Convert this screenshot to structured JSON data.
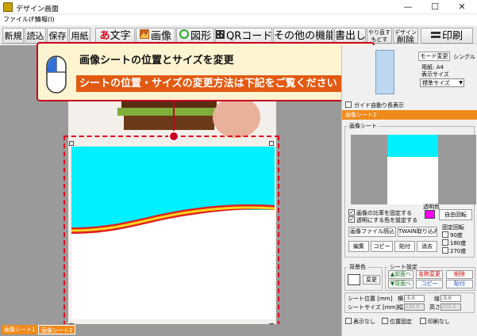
{
  "window": {
    "title": "デザイン画面",
    "minimize": "—",
    "maximize": "☐",
    "close": "✕"
  },
  "menu": [
    "ファイル(F)",
    "情報(I)"
  ],
  "toolbar": {
    "new": "新規",
    "load": "読込",
    "save": "保存",
    "paper": "用紙",
    "text_glyph": "あ",
    "text": "文字",
    "image": "画像",
    "shape": "図形",
    "qr": "QRコード",
    "other": "その他の機能",
    "write_out": "書出し",
    "redo_top": "やり直す",
    "redo_bottom": "もどす",
    "delete_top": "デザイン",
    "delete_bottom": "削除",
    "print": "印刷"
  },
  "callout": {
    "title": "画像シートの位置とサイズを変更",
    "subtitle": "シートの位置・サイズの変更方法は下記をご覧ください"
  },
  "sheet_tabs": [
    "画像シート1",
    "画像シート2"
  ],
  "right_panel": {
    "mode_change": "モード変更",
    "single": "シングル",
    "paper_label": "用紙",
    "paper_value": "A4",
    "display_size_label": "表示サイズ",
    "display_size_value": "標準サイズ",
    "guide_auto": "ガイド自動り長表示",
    "sheet_header": "画像シート2",
    "image_sheet_group": "画像シート",
    "fix_ratio": "画像の比率を固定する",
    "transparent_color": "透明にする色を設定する",
    "transparent_label": "透明色",
    "free_rotate": "自由回転",
    "load_image_file": "画像ファイル読込",
    "twain": "TWAIN取り込み",
    "edit": "編集",
    "copy": "コピー",
    "paste": "貼付",
    "erase": "消去",
    "fixed_rotate": "固定回転",
    "rot_90": "90度",
    "rot_180": "180度",
    "rot_270": "270度",
    "bg_color_label": "背景色",
    "change": "変更",
    "sheet_settings": "シート設定",
    "to_front": "▲前面へ",
    "to_back": "▼背面へ",
    "rename": "名称変更",
    "sheet_copy": "コピー",
    "sheet_delete": "削除",
    "sheet_paste": "貼付",
    "pos_label": "シート位置 [mm]",
    "size_label": "シートサイズ [mm]",
    "x_label": "横",
    "y_label": "縦",
    "w_label": "幅",
    "h_label": "高さ",
    "x_value": "-5.0",
    "y_value": "-5.0",
    "w_value": "220.0",
    "h_value": "225.0",
    "hide": "表示なし",
    "pos_fix": "位置固定",
    "no_print": "印刷なし"
  },
  "colors": {
    "accent_orange": "#f08a1c",
    "callout_red": "#c8001e",
    "callout_band": "#e25a12",
    "cyan": "#00f0ff",
    "transparent_swatch": "#ff00ff"
  },
  "icons": {
    "mouse": "mouse-icon",
    "image": "image-icon",
    "shape": "circle-shape-icon",
    "qr": "qr-icon",
    "print": "print-icon"
  }
}
